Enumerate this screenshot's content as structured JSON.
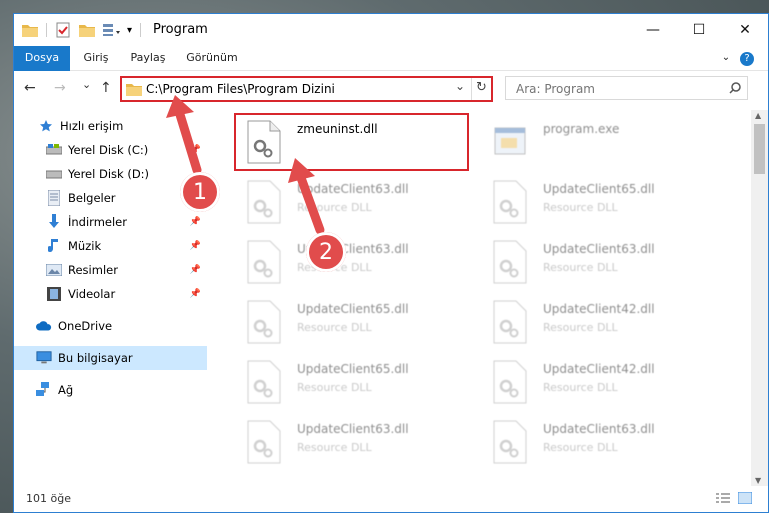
{
  "window": {
    "title": "Program",
    "controls": {
      "minimize": "—",
      "maximize": "☐",
      "close": "✕"
    }
  },
  "ribbon": {
    "tabs": [
      "Dosya",
      "Giriş",
      "Paylaş",
      "Görünüm"
    ],
    "help": "?"
  },
  "nav": {
    "back": "←",
    "forward": "→",
    "recent": "⌄",
    "up": "↑",
    "address": "C:\\Program Files\\Program Dizini",
    "refresh": "↻",
    "dropdown": "⌄",
    "search_placeholder": "Ara: Program",
    "search_icon": "search-icon"
  },
  "sidebar": {
    "items": [
      {
        "label": "Hızlı erişim",
        "icon": "star-icon"
      },
      {
        "label": "Yerel Disk (C:)",
        "icon": "drive-icon"
      },
      {
        "label": "Yerel Disk (D:)",
        "icon": "drive-icon"
      },
      {
        "label": "Belgeler",
        "icon": "document-icon"
      },
      {
        "label": "İndirmeler",
        "icon": "download-icon"
      },
      {
        "label": "Müzik",
        "icon": "music-icon"
      },
      {
        "label": "Resimler",
        "icon": "pictures-icon"
      },
      {
        "label": "Videolar",
        "icon": "video-icon"
      },
      {
        "label": "OneDrive",
        "icon": "cloud-icon"
      },
      {
        "label": "Bu bilgisayar",
        "icon": "computer-icon"
      },
      {
        "label": "Ağ",
        "icon": "network-icon"
      }
    ]
  },
  "files": [
    {
      "name": "zmeuninst.dll",
      "type": ""
    },
    {
      "name": "program.exe",
      "type": ""
    },
    {
      "name": "UpdateClient63.dll",
      "type": "Resource DLL"
    },
    {
      "name": "UpdateClient65.dll",
      "type": "Resource DLL"
    },
    {
      "name": "UpdateClient63.dll",
      "type": "Resource DLL"
    },
    {
      "name": "UpdateClient63.dll",
      "type": "Resource DLL"
    },
    {
      "name": "UpdateClient65.dll",
      "type": "Resource DLL"
    },
    {
      "name": "UpdateClient42.dll",
      "type": "Resource DLL"
    },
    {
      "name": "UpdateClient65.dll",
      "type": "Resource DLL"
    },
    {
      "name": "UpdateClient42.dll",
      "type": "Resource DLL"
    },
    {
      "name": "UpdateClient63.dll",
      "type": "Resource DLL"
    },
    {
      "name": "UpdateClient63.dll",
      "type": "Resource DLL"
    }
  ],
  "annotations": {
    "step1": "1",
    "step2": "2"
  },
  "status": {
    "count": "101 öğe"
  },
  "colors": {
    "accent": "#1979ca",
    "highlight": "#d8262c",
    "selection": "#cce8ff"
  }
}
